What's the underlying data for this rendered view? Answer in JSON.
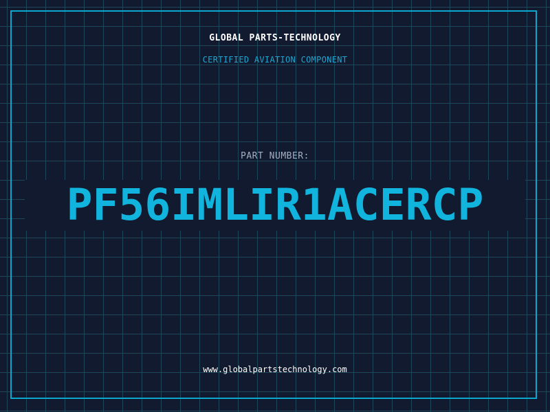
{
  "card": {
    "company": "GLOBAL PARTS-TECHNOLOGY",
    "tagline": "CERTIFIED AVIATION COMPONENT",
    "part_number_label": "PART NUMBER:",
    "part_number": "PF56IMLIR1ACERCP",
    "website": "www.globalpartstechnology.com"
  },
  "colors": {
    "background": "#111a2e",
    "grid": "#1d4658",
    "frame": "#0aa8cc",
    "accent": "#10b4dc",
    "heading": "#ffffff",
    "label": "#a4afc4"
  }
}
